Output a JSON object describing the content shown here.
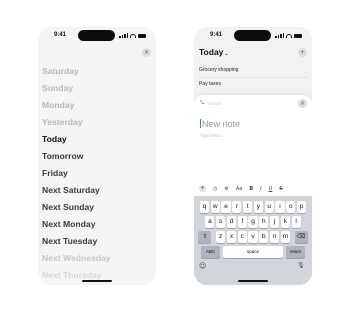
{
  "left_phone": {
    "time": "9:41",
    "close_glyph": "×",
    "days": [
      {
        "label": "Saturday",
        "state": "muted"
      },
      {
        "label": "Sunday",
        "state": "muted"
      },
      {
        "label": "Monday",
        "state": "muted"
      },
      {
        "label": "Yesterday",
        "state": "muted"
      },
      {
        "label": "Today",
        "state": "selected"
      },
      {
        "label": "Tomorrow",
        "state": "normal"
      },
      {
        "label": "Friday",
        "state": "normal"
      },
      {
        "label": "Next Saturday",
        "state": "normal"
      },
      {
        "label": "Next Sunday",
        "state": "normal"
      },
      {
        "label": "Next Monday",
        "state": "normal"
      },
      {
        "label": "Next Tuesday",
        "state": "normal"
      },
      {
        "label": "Next Wednesday",
        "state": "faded"
      },
      {
        "label": "Next Thursday",
        "state": "faded"
      }
    ]
  },
  "right_phone": {
    "time": "9:41",
    "header_title": "Today",
    "header_chevron": "⌄",
    "add_glyph": "+",
    "tasks": [
      "Grocery shopping",
      "Pay taxes"
    ],
    "sheet": {
      "drag_glyph": "⤡",
      "close_glyph": "×",
      "title_placeholder": "New note",
      "body_placeholder": "Type here..."
    },
    "toolbar": [
      {
        "name": "add",
        "glyph": "+"
      },
      {
        "name": "clock",
        "glyph": "◷"
      },
      {
        "name": "settings",
        "glyph": "⚙"
      },
      {
        "name": "font-size",
        "glyph": "Aa"
      },
      {
        "name": "bold",
        "glyph": "B"
      },
      {
        "name": "italic",
        "glyph": "I"
      },
      {
        "name": "underline",
        "glyph": "U"
      },
      {
        "name": "strikethrough",
        "glyph": "S"
      }
    ],
    "keyboard": {
      "row1": [
        "q",
        "w",
        "e",
        "r",
        "t",
        "y",
        "u",
        "i",
        "o",
        "p"
      ],
      "row2": [
        "a",
        "s",
        "d",
        "f",
        "g",
        "h",
        "j",
        "k",
        "l"
      ],
      "row3": [
        "z",
        "x",
        "c",
        "v",
        "b",
        "n",
        "m"
      ],
      "shift": "⇧",
      "delete": "⌫",
      "abc": "ABC",
      "space": "space",
      "return": "return",
      "emoji": "☺",
      "mic": "🎙"
    }
  }
}
